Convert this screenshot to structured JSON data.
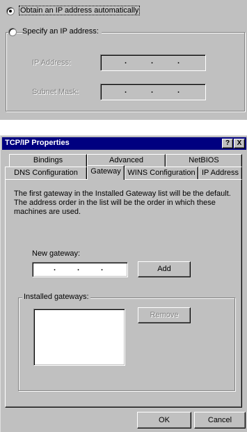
{
  "ip_panel": {
    "obtain_auto_label": "Obtain an IP address automatically",
    "specify_label": "Specify an IP address:",
    "ip_address_label": "IP Address:",
    "subnet_mask_label": "Subnet Mask:",
    "obtain_selected": true
  },
  "dialog": {
    "title": "TCP/IP Properties",
    "help_button": "?",
    "close_button": "X",
    "tabs_back": [
      "Bindings",
      "Advanced",
      "NetBIOS"
    ],
    "tabs_front": [
      "DNS Configuration",
      "Gateway",
      "WINS Configuration",
      "IP Address"
    ],
    "active_tab": "Gateway",
    "description": "The first gateway in the Installed Gateway list will be the default. The address order in the list will be the order in which these machines are used.",
    "new_gateway_label": "New gateway:",
    "add_button": "Add",
    "installed_gateways_label": "Installed gateways:",
    "remove_button": "Remove",
    "ok_button": "OK",
    "cancel_button": "Cancel"
  },
  "colors": {
    "title_bar": "#000080",
    "face": "#c0c0c0"
  }
}
